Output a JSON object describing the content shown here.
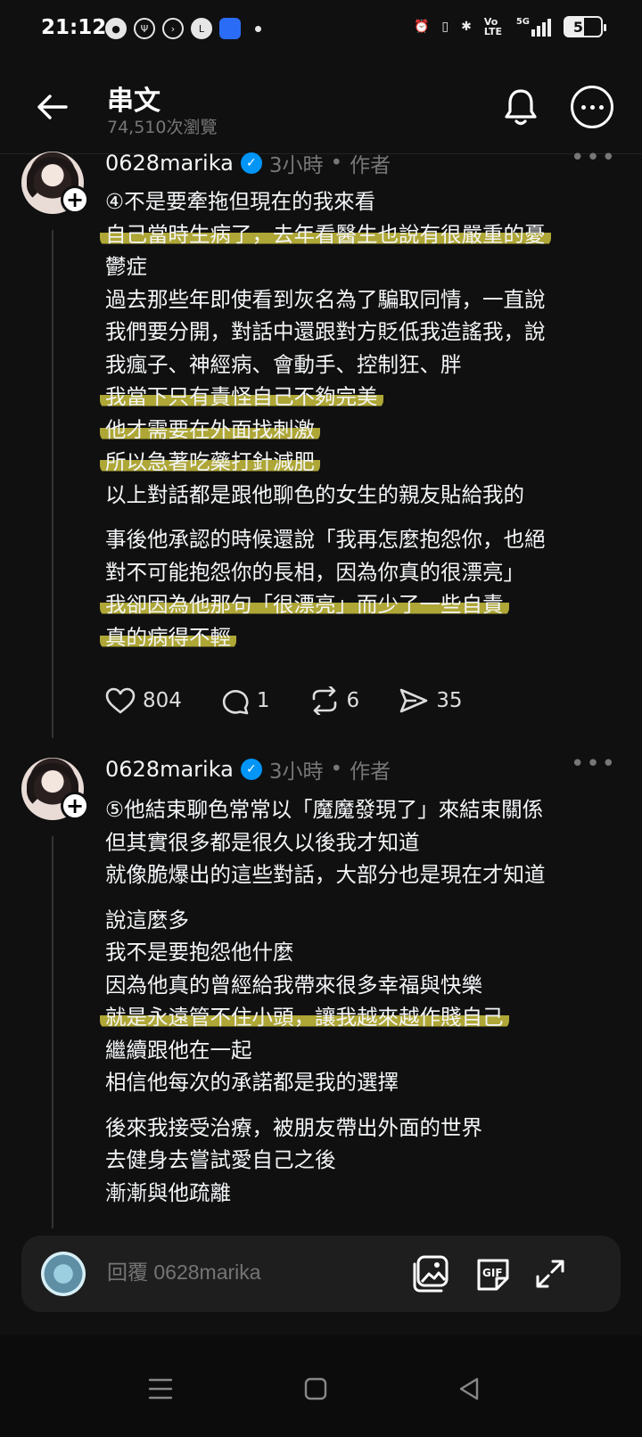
{
  "status_bar": {
    "time": "21:12",
    "battery": "51",
    "network": "5G",
    "volte": "Vo LTE"
  },
  "header": {
    "title": "串文",
    "views": "74,510次瀏覽"
  },
  "posts": [
    {
      "username": "0628marika",
      "time": "3小時",
      "role": "作者",
      "lines": [
        {
          "text": "④不是要牽拖但現在的我來看",
          "hl": false
        },
        {
          "text": "自己當時生病了，去年看醫生也說有很嚴重的憂",
          "hl": true
        },
        {
          "text": "鬱症",
          "hl": false
        },
        {
          "text": "過去那些年即使看到灰名為了騙取同情，一直說",
          "hl": false
        },
        {
          "text": "我們要分開，對話中還跟對方貶低我造謠我，說",
          "hl": false
        },
        {
          "text": "我瘋子、神經病、會動手、控制狂、胖",
          "hl": false
        },
        {
          "text": "我當下只有責怪自己不夠完美",
          "hl": true
        },
        {
          "text": "他才需要在外面找刺激",
          "hl": true
        },
        {
          "text": "所以急著吃藥打針減肥",
          "hl": true
        },
        {
          "text": "以上對話都是跟他聊色的女生的親友貼給我的",
          "hl": false
        },
        {
          "text": "",
          "hl": false
        },
        {
          "text": "事後他承認的時候還說「我再怎麼抱怨你，也絕",
          "hl": false
        },
        {
          "text": "對不可能抱怨你的長相，因為你真的很漂亮」",
          "hl": false
        },
        {
          "text": "我卻因為他那句「很漂亮」而少了一些自責",
          "hl": true
        },
        {
          "text": "真的病得不輕",
          "hl": true
        }
      ],
      "likes": "804",
      "comments": "1",
      "reposts": "6",
      "shares": "35"
    },
    {
      "username": "0628marika",
      "time": "3小時",
      "role": "作者",
      "lines": [
        {
          "text": "⑤他結束聊色常常以「魔魔發現了」來結束關係",
          "hl": false
        },
        {
          "text": "但其實很多都是很久以後我才知道",
          "hl": false
        },
        {
          "text": "就像脆爆出的這些對話，大部分也是現在才知道",
          "hl": false
        },
        {
          "text": "",
          "hl": false
        },
        {
          "text": "說這麼多",
          "hl": false
        },
        {
          "text": "我不是要抱怨他什麼",
          "hl": false
        },
        {
          "text": "因為他真的曾經給我帶來很多幸福與快樂",
          "hl": false
        },
        {
          "text": "就是永遠管不住小頭，讓我越來越作賤自己",
          "hl": true
        },
        {
          "text": "繼續跟他在一起",
          "hl": false
        },
        {
          "text": "相信他每次的承諾都是我的選擇",
          "hl": false
        },
        {
          "text": "",
          "hl": false
        },
        {
          "text": "後來我接受治療，被朋友帶出外面的世界",
          "hl": false
        },
        {
          "text": "去健身去嘗試愛自己之後",
          "hl": false
        },
        {
          "text": "漸漸與他疏離",
          "hl": false
        }
      ]
    }
  ],
  "reply_bar": {
    "placeholder": "回覆 0628marika"
  },
  "icons": {
    "back": "back-arrow-icon",
    "bell": "bell-icon",
    "more": "more-icon",
    "heart": "heart-icon",
    "comment": "comment-icon",
    "repost": "repost-icon",
    "share": "share-icon",
    "image": "image-icon",
    "gif": "gif-icon",
    "expand": "expand-icon"
  },
  "colors": {
    "background": "#101010",
    "highlight": "#cac03c",
    "verified": "#0095f6",
    "muted": "#777777"
  }
}
